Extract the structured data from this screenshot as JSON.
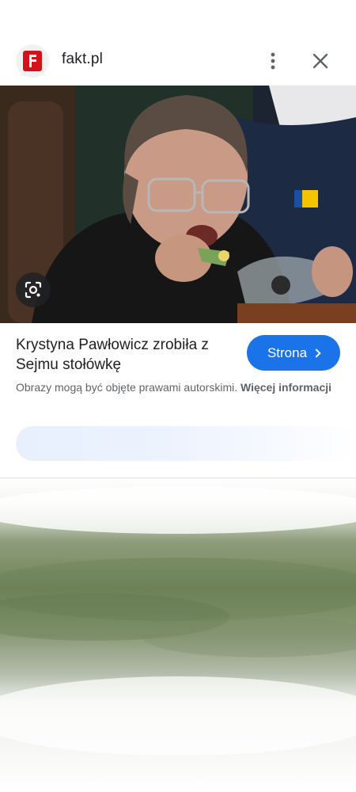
{
  "header": {
    "site_name": "fakt.pl",
    "logo_icon": "fakt-logo-icon",
    "more_icon": "more-vert-icon",
    "close_icon": "close-icon"
  },
  "image": {
    "lens_icon": "google-lens-icon"
  },
  "result": {
    "title": "Krystyna Pawłowicz zrobiła z Sejmu stołówkę",
    "visit_label": "Strona",
    "copyright_text": "Obrazy mogą być objęte prawami autorskimi.",
    "more_info_label": "Więcej informacji"
  },
  "colors": {
    "accent": "#1a73e8",
    "logo_red": "#d3121a",
    "text_primary": "#202124",
    "text_secondary": "#5f6368"
  }
}
